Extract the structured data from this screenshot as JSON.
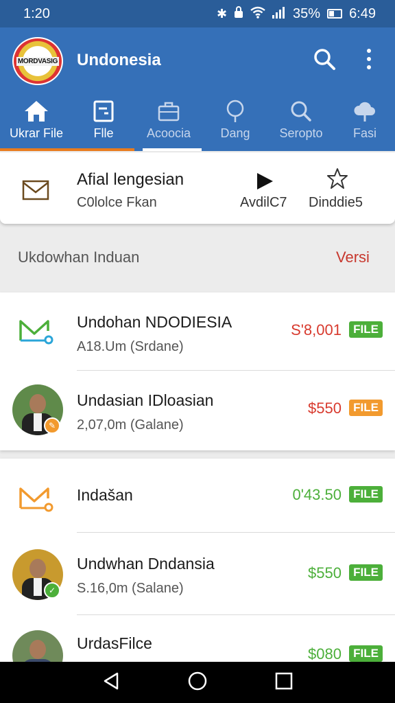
{
  "status_bar": {
    "left_time": "1:20",
    "battery_pct": "35%",
    "right_time": "6:49"
  },
  "app_bar": {
    "logo_text": "MORDVASIG",
    "title": "Undonesia",
    "accent_color": "#3570b8"
  },
  "tabs": [
    {
      "label": "Ukrar File",
      "icon": "home-icon",
      "underline_color": "#e87b1e"
    },
    {
      "label": "Flle",
      "icon": "file-icon"
    },
    {
      "label": "Acoocia",
      "icon": "briefcase-icon",
      "underline_color": "#ffffff"
    },
    {
      "label": "Dang",
      "icon": "tree-icon"
    },
    {
      "label": "Seropto",
      "icon": "search-icon"
    },
    {
      "label": "Fasi",
      "icon": "cloud-icon"
    }
  ],
  "featured": {
    "title": "Afial lengesian",
    "subtitle": "C0lolce Fkan",
    "play_label": "AvdilC7",
    "star_label": "Dinddie5"
  },
  "section": {
    "title": "Ukdowhan Induan",
    "action": "Versi"
  },
  "list_group_1": [
    {
      "title": "Undohan  NDODIESIA",
      "subtitle": "A18.Um (Srdane)",
      "price": "S'8,001",
      "price_color": "#d83a2e",
      "badge": "FILE",
      "badge_color": "#4caf3a",
      "icon": "mail-icon"
    },
    {
      "title": "Undasian IDloasian",
      "subtitle": "2,07,0m (Galane)",
      "price": "$550",
      "price_color": "#d83a2e",
      "badge": "FILE",
      "badge_color": "#f29a2e",
      "icon": "avatar"
    }
  ],
  "list_group_2": [
    {
      "title": "Indašan",
      "subtitle": "",
      "price": "0'43.50",
      "price_color": "#4caf3a",
      "badge": "FILE",
      "badge_color": "#4caf3a",
      "icon": "mail-icon"
    },
    {
      "title": "Undwhan Dndansia",
      "subtitle": "S.16,0m (Salane)",
      "price": "$550",
      "price_color": "#4caf3a",
      "badge": "FILE",
      "badge_color": "#4caf3a",
      "icon": "avatar"
    },
    {
      "title": "UrdasFilce",
      "subtitle": "",
      "price": "$080",
      "price_color": "#4caf3a",
      "badge": "FILE",
      "badge_color": "#4caf3a",
      "icon": "avatar"
    }
  ]
}
